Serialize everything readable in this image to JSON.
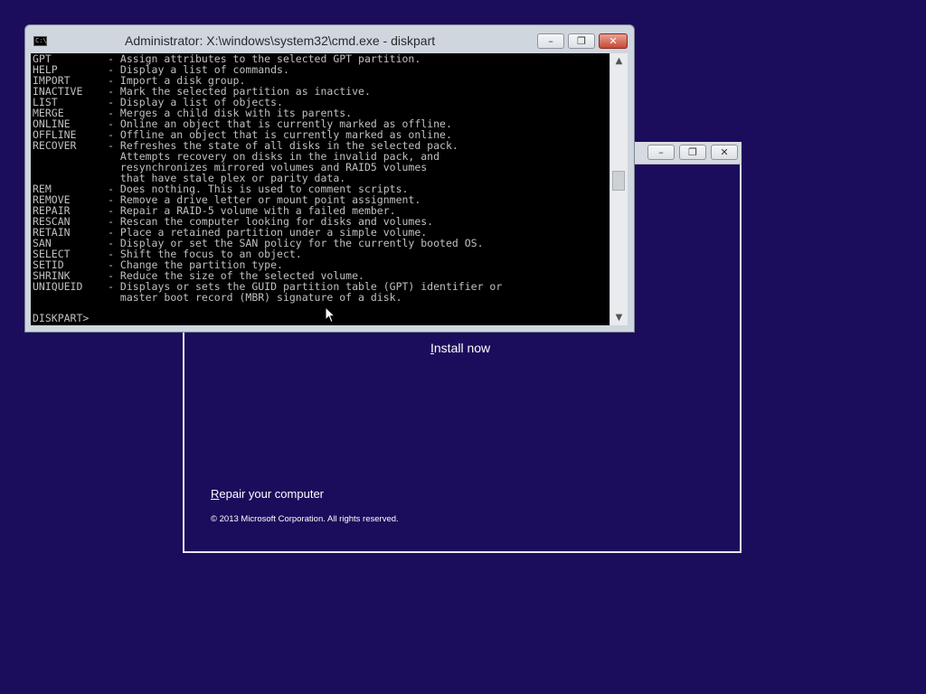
{
  "setup_window": {
    "install_now": "Install now",
    "repair_computer": "Repair your computer",
    "copyright": "© 2013 Microsoft Corporation. All rights reserved.",
    "buttons": {
      "minimize": "–",
      "restore": "❐",
      "close": "✕"
    }
  },
  "cmd_window": {
    "icon_text": "C:\\",
    "title": "Administrator: X:\\windows\\system32\\cmd.exe - diskpart",
    "buttons": {
      "minimize": "–",
      "restore": "❐",
      "close": "✕"
    },
    "console_lines": [
      "GPT         - Assign attributes to the selected GPT partition.",
      "HELP        - Display a list of commands.",
      "IMPORT      - Import a disk group.",
      "INACTIVE    - Mark the selected partition as inactive.",
      "LIST        - Display a list of objects.",
      "MERGE       - Merges a child disk with its parents.",
      "ONLINE      - Online an object that is currently marked as offline.",
      "OFFLINE     - Offline an object that is currently marked as online.",
      "RECOVER     - Refreshes the state of all disks in the selected pack.",
      "              Attempts recovery on disks in the invalid pack, and",
      "              resynchronizes mirrored volumes and RAID5 volumes",
      "              that have stale plex or parity data.",
      "REM         - Does nothing. This is used to comment scripts.",
      "REMOVE      - Remove a drive letter or mount point assignment.",
      "REPAIR      - Repair a RAID-5 volume with a failed member.",
      "RESCAN      - Rescan the computer looking for disks and volumes.",
      "RETAIN      - Place a retained partition under a simple volume.",
      "SAN         - Display or set the SAN policy for the currently booted OS.",
      "SELECT      - Shift the focus to an object.",
      "SETID       - Change the partition type.",
      "SHRINK      - Reduce the size of the selected volume.",
      "UNIQUEID    - Displays or sets the GUID partition table (GPT) identifier or",
      "              master boot record (MBR) signature of a disk."
    ],
    "prompt": "DISKPART>",
    "scroll_up": "▲",
    "scroll_down": "▼"
  }
}
